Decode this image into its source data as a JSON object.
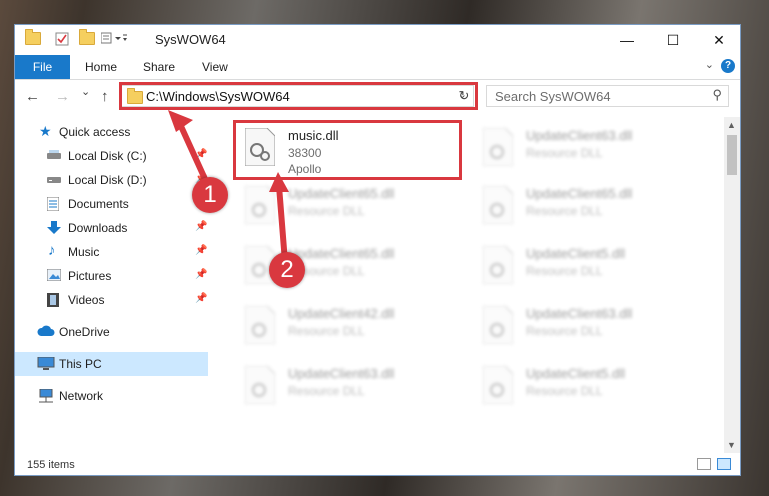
{
  "window": {
    "title": "SysWOW64"
  },
  "titlebar": {
    "minimize": "—",
    "maximize": "☐",
    "close": "✕"
  },
  "ribbon": {
    "tabs": [
      "File",
      "Home",
      "Share",
      "View"
    ],
    "help": "?"
  },
  "nav": {
    "back": "←",
    "forward": "→",
    "recent": "⌄",
    "up": "↑",
    "address": "C:\\Windows\\SysWOW64",
    "refresh": "↻",
    "search_placeholder": "Search SysWOW64"
  },
  "sidebar": {
    "items": [
      {
        "label": "Quick access",
        "icon": "star-icon",
        "pinned": false
      },
      {
        "label": "Local Disk (C:)",
        "icon": "drive-icon",
        "pinned": true
      },
      {
        "label": "Local Disk (D:)",
        "icon": "drive-icon",
        "pinned": true
      },
      {
        "label": "Documents",
        "icon": "documents-icon",
        "pinned": true
      },
      {
        "label": "Downloads",
        "icon": "download-icon",
        "pinned": true
      },
      {
        "label": "Music",
        "icon": "music-icon",
        "pinned": true
      },
      {
        "label": "Pictures",
        "icon": "pictures-icon",
        "pinned": true
      },
      {
        "label": "Videos",
        "icon": "videos-icon",
        "pinned": true
      },
      {
        "label": "OneDrive",
        "icon": "cloud-icon",
        "pinned": false
      },
      {
        "label": "This PC",
        "icon": "computer-icon",
        "pinned": false,
        "selected": true
      },
      {
        "label": "Network",
        "icon": "network-icon",
        "pinned": false
      }
    ],
    "pin_glyph": "📌"
  },
  "files": [
    {
      "name": "music.dll",
      "line2": "38300",
      "line3": "Apollo",
      "highlighted": true
    },
    {
      "name": "UpdateClient63.dll",
      "line2": "Resource DLL",
      "line3": ""
    },
    {
      "name": "UpdateClient65.dll",
      "line2": "Resource DLL",
      "line3": ""
    },
    {
      "name": "UpdateClient65.dll",
      "line2": "Resource DLL",
      "line3": ""
    },
    {
      "name": "UpdateClient65.dll",
      "line2": "Resource DLL",
      "line3": ""
    },
    {
      "name": "UpdateClient5.dll",
      "line2": "Resource DLL",
      "line3": ""
    },
    {
      "name": "UpdateClient42.dll",
      "line2": "Resource DLL",
      "line3": ""
    },
    {
      "name": "UpdateClient63.dll",
      "line2": "Resource DLL",
      "line3": ""
    },
    {
      "name": "UpdateClient63.dll",
      "line2": "Resource DLL",
      "line3": ""
    },
    {
      "name": "UpdateClient5.dll",
      "line2": "Resource DLL",
      "line3": ""
    }
  ],
  "status": {
    "count": "155 items"
  },
  "callouts": [
    "1",
    "2"
  ],
  "colors": {
    "accent": "#1979ca",
    "highlight": "#d9383f",
    "selected": "#cce8ff"
  }
}
